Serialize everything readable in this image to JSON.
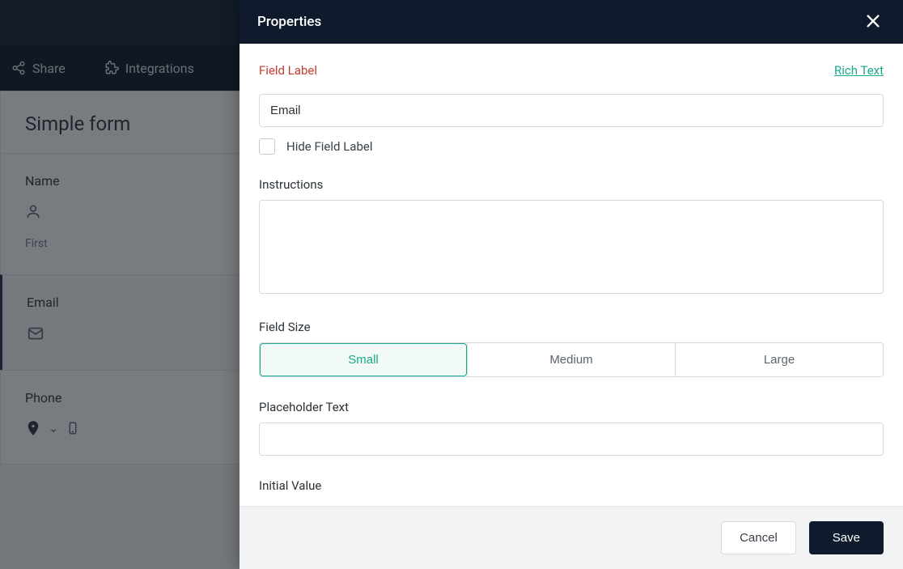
{
  "nav": {
    "share": "Share",
    "integrations": "Integrations"
  },
  "form": {
    "title": "Simple form",
    "fields": {
      "name": {
        "label": "Name",
        "sub": "First"
      },
      "email": {
        "label": "Email"
      },
      "phone": {
        "label": "Phone"
      }
    }
  },
  "panel": {
    "title": "Properties",
    "field_label_title": "Field Label",
    "rich_text": "Rich Text",
    "field_label_value": "Email",
    "hide_field_label": "Hide Field Label",
    "instructions_label": "Instructions",
    "instructions_value": "",
    "field_size_label": "Field Size",
    "sizes": {
      "small": "Small",
      "medium": "Medium",
      "large": "Large"
    },
    "placeholder_label": "Placeholder Text",
    "placeholder_value": "",
    "initial_value_label": "Initial Value",
    "cancel": "Cancel",
    "save": "Save"
  }
}
